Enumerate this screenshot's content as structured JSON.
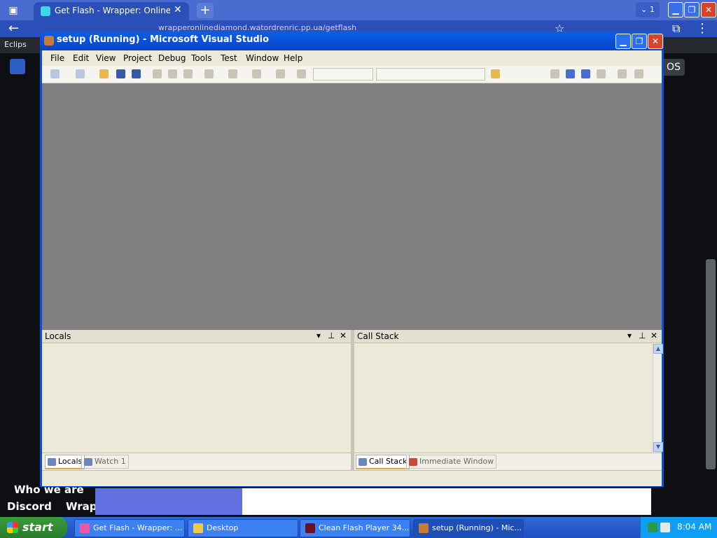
{
  "browser": {
    "tab_title": "Get Flash - Wrapper: Online Diamo",
    "tab_count": "1",
    "url": "wrapperonlinediamond.watordrenric.pp.ua/getflash",
    "bookmark": "Eclips",
    "window_minimize": "▁",
    "window_maximize": "❐",
    "window_close": "✕",
    "new_tab": "+",
    "tab_close": "✕"
  },
  "site": {
    "os_label": "OS",
    "footer_line1": "Who we are",
    "footer_line2a": "Discord",
    "footer_line2b": "Wrap"
  },
  "vs": {
    "title": "setup (Running) - Microsoft Visual Studio",
    "menu": [
      "File",
      "Edit",
      "View",
      "Project",
      "Debug",
      "Tools",
      "Test",
      "Window",
      "Help"
    ],
    "left_pane": {
      "title": "Locals",
      "tabs": [
        "Locals",
        "Watch 1"
      ]
    },
    "right_pane": {
      "title": "Call Stack",
      "tabs": [
        "Call Stack",
        "Immediate Window"
      ]
    },
    "pane_controls": {
      "dropdown": "▾",
      "pin": "⊥",
      "close": "✕"
    }
  },
  "taskbar": {
    "start": "start",
    "tasks": [
      "Get Flash - Wrapper: ...",
      "Desktop",
      "Clean Flash Player 34....",
      "setup (Running) - Mic..."
    ],
    "clock": "8:04 AM"
  },
  "colors": {
    "xp_blue": "#0054e3",
    "editor_gray": "#808080",
    "panel_beige": "#ece9d8",
    "chrome_blue": "#4a6cd0"
  }
}
